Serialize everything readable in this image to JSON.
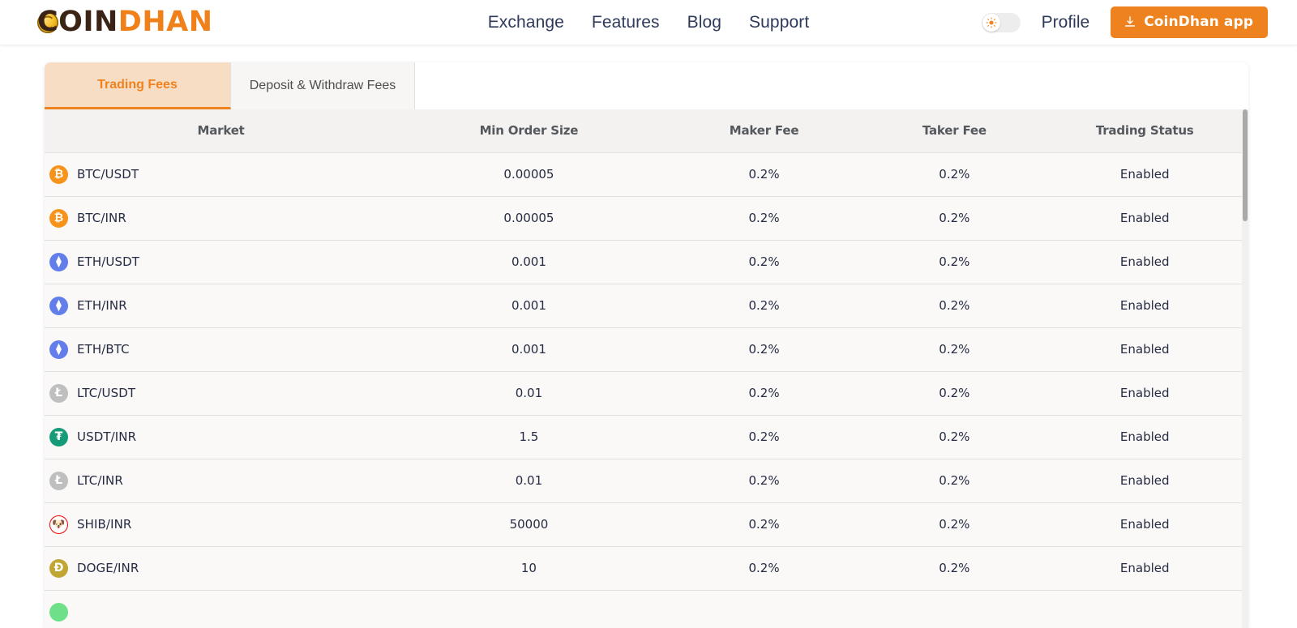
{
  "header": {
    "logo": {
      "part_dark": "COIN",
      "part_orange": "DHAN",
      "coin_icon": "gold-coin-icon"
    },
    "nav": [
      {
        "label": "Exchange"
      },
      {
        "label": "Features"
      },
      {
        "label": "Blog"
      },
      {
        "label": "Support"
      }
    ],
    "theme_toggle": {
      "icon": "sun-icon",
      "state": "light"
    },
    "profile_label": "Profile",
    "app_button": {
      "label": "CoinDhan app",
      "icon": "download-icon",
      "color": "#ee821f"
    }
  },
  "tabs": [
    {
      "label": "Trading Fees",
      "active": true
    },
    {
      "label": "Deposit & Withdraw Fees",
      "active": false
    }
  ],
  "table": {
    "columns": [
      "Market",
      "Min Order Size",
      "Maker Fee",
      "Taker Fee",
      "Trading Status"
    ],
    "rows": [
      {
        "market": "BTC/USDT",
        "icon": "btc-icon",
        "glyph": "₿",
        "icon_class": "ic-btc",
        "min_order_size": "0.00005",
        "maker_fee": "0.2%",
        "taker_fee": "0.2%",
        "status": "Enabled"
      },
      {
        "market": "BTC/INR",
        "icon": "btc-icon",
        "glyph": "₿",
        "icon_class": "ic-btc",
        "min_order_size": "0.00005",
        "maker_fee": "0.2%",
        "taker_fee": "0.2%",
        "status": "Enabled"
      },
      {
        "market": "ETH/USDT",
        "icon": "eth-icon",
        "glyph": "⧫",
        "icon_class": "ic-eth",
        "min_order_size": "0.001",
        "maker_fee": "0.2%",
        "taker_fee": "0.2%",
        "status": "Enabled"
      },
      {
        "market": "ETH/INR",
        "icon": "eth-icon",
        "glyph": "⧫",
        "icon_class": "ic-eth",
        "min_order_size": "0.001",
        "maker_fee": "0.2%",
        "taker_fee": "0.2%",
        "status": "Enabled"
      },
      {
        "market": "ETH/BTC",
        "icon": "eth-icon",
        "glyph": "⧫",
        "icon_class": "ic-eth",
        "min_order_size": "0.001",
        "maker_fee": "0.2%",
        "taker_fee": "0.2%",
        "status": "Enabled"
      },
      {
        "market": "LTC/USDT",
        "icon": "ltc-icon",
        "glyph": "Ł",
        "icon_class": "ic-ltc",
        "min_order_size": "0.01",
        "maker_fee": "0.2%",
        "taker_fee": "0.2%",
        "status": "Enabled"
      },
      {
        "market": "USDT/INR",
        "icon": "usdt-icon",
        "glyph": "₮",
        "icon_class": "ic-usdt",
        "min_order_size": "1.5",
        "maker_fee": "0.2%",
        "taker_fee": "0.2%",
        "status": "Enabled"
      },
      {
        "market": "LTC/INR",
        "icon": "ltc-icon",
        "glyph": "Ł",
        "icon_class": "ic-ltc",
        "min_order_size": "0.01",
        "maker_fee": "0.2%",
        "taker_fee": "0.2%",
        "status": "Enabled"
      },
      {
        "market": "SHIB/INR",
        "icon": "shib-icon",
        "glyph": "🐶",
        "icon_class": "ic-shib",
        "min_order_size": "50000",
        "maker_fee": "0.2%",
        "taker_fee": "0.2%",
        "status": "Enabled"
      },
      {
        "market": "DOGE/INR",
        "icon": "doge-icon",
        "glyph": "Ð",
        "icon_class": "ic-doge",
        "min_order_size": "10",
        "maker_fee": "0.2%",
        "taker_fee": "0.2%",
        "status": "Enabled"
      },
      {
        "market": "",
        "icon": "coin-icon",
        "glyph": "",
        "icon_class": "ic-green",
        "min_order_size": "",
        "maker_fee": "",
        "taker_fee": "",
        "status": ""
      }
    ]
  },
  "colors": {
    "brand_orange": "#ee821f",
    "nav_navy": "#2e3a59",
    "status_green": "#2ecb7f",
    "tab_active_bg": "#f7ddc4"
  }
}
